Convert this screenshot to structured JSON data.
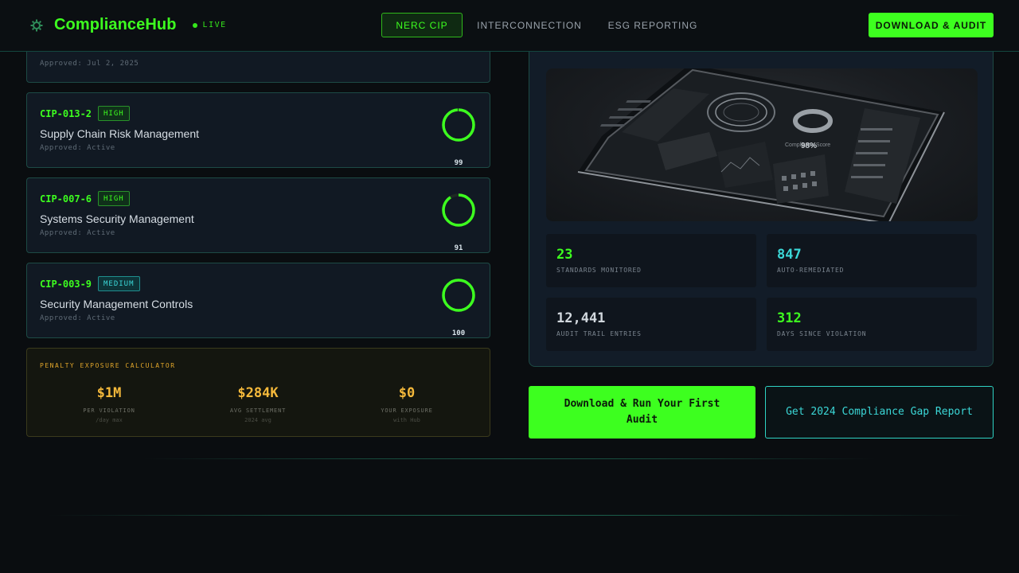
{
  "nav": {
    "brand": "ComplianceHub",
    "live": "LIVE",
    "tabs": [
      {
        "label": "NERC CIP",
        "active": true
      },
      {
        "label": "INTERCONNECTION",
        "active": false
      },
      {
        "label": "ESG REPORTING",
        "active": false
      }
    ],
    "cta": "DOWNLOAD & AUDIT"
  },
  "standards": [
    {
      "code": "",
      "severity": "",
      "title": "",
      "approved": "Approved: Jul 2, 2025",
      "score": null
    },
    {
      "code": "CIP-013-2",
      "severity": "HIGH",
      "title": "Supply Chain Risk Management",
      "approved": "Approved: Active",
      "score": 99
    },
    {
      "code": "CIP-007-6",
      "severity": "HIGH",
      "title": "Systems Security Management",
      "approved": "Approved: Active",
      "score": 91
    },
    {
      "code": "CIP-003-9",
      "severity": "MEDIUM",
      "title": "Security Management Controls",
      "approved": "Approved: Active",
      "score": 100
    }
  ],
  "penalty": {
    "title": "PENALTY EXPOSURE CALCULATOR",
    "items": [
      {
        "value": "$1M",
        "label": "PER VIOLATION",
        "sub": "/day max"
      },
      {
        "value": "$284K",
        "label": "AVG SETTLEMENT",
        "sub": "2024 avg"
      },
      {
        "value": "$0",
        "label": "YOUR EXPOSURE",
        "sub": "with Hub"
      }
    ]
  },
  "stats": [
    {
      "value": "23",
      "label": "STANDARDS MONITORED",
      "color": "#3dff1f"
    },
    {
      "value": "847",
      "label": "AUTO-REMEDIATED",
      "color": "#3bd7d7"
    },
    {
      "value": "12,441",
      "label": "AUDIT TRAIL ENTRIES",
      "color": "#d2d8de"
    },
    {
      "value": "312",
      "label": "DAYS SINCE VIOLATION",
      "color": "#3dff1f"
    }
  ],
  "device": {
    "score_label": "Compliance Score",
    "score": "98%"
  },
  "cta": {
    "primary": "Download & Run Your First Audit",
    "secondary": "Get 2024 Compliance Gap Report"
  },
  "colors": {
    "accent": "#3dff1f",
    "teal": "#3bd7d7",
    "amber": "#f5b93b"
  }
}
